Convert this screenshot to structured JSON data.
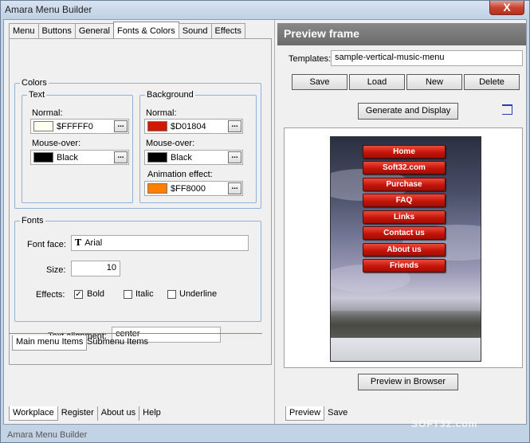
{
  "window": {
    "title": "Amara Menu Builder",
    "close_label": "X",
    "footer": "Amara Menu Builder"
  },
  "tabs": [
    "Menu",
    "Buttons",
    "General",
    "Fonts & Colors",
    "Sound",
    "Effects"
  ],
  "colors": {
    "legend": "Colors",
    "text": {
      "legend": "Text",
      "normal_label": "Normal:",
      "normal_value": "$FFFFF0",
      "normal_color": "#FFFFF0",
      "mouseover_label": "Mouse-over:",
      "mouseover_value": "Black",
      "mouseover_color": "#000000"
    },
    "background": {
      "legend": "Background",
      "normal_label": "Normal:",
      "normal_value": "$D01804",
      "normal_color": "#D01804",
      "mouseover_label": "Mouse-over:",
      "mouseover_value": "Black",
      "mouseover_color": "#000000",
      "animation_label": "Animation effect:",
      "animation_value": "$FF8000",
      "animation_color": "#FF8000"
    },
    "dots": "..."
  },
  "fonts": {
    "legend": "Fonts",
    "face_label": "Font face:",
    "face_value": "Arial",
    "size_label": "Size:",
    "size_value": "10",
    "effects_label": "Effects:",
    "bold_label": "Bold",
    "bold_checked": true,
    "italic_label": "Italic",
    "underline_label": "Underline"
  },
  "alignment": {
    "label": "Text alignment:",
    "value": "center"
  },
  "subtabs": [
    "Main menu Items",
    "Submenu Items"
  ],
  "bottom_tabs": [
    "Workplace",
    "Register",
    "About us",
    "Help"
  ],
  "preview": {
    "header": "Preview frame",
    "templates_label": "Templates:",
    "templates_value": "sample-vertical-music-menu",
    "save": "Save",
    "load": "Load",
    "new": "New",
    "delete": "Delete",
    "generate": "Generate and Display",
    "menu_items": [
      "Home",
      "Soft32.com",
      "Purchase",
      "FAQ",
      "Links",
      "Contact us",
      "About us",
      "Friends"
    ],
    "preview_in_browser": "Preview in Browser",
    "bottom_tabs": [
      "Preview",
      "Save"
    ]
  },
  "watermark": "SOFT32.com"
}
